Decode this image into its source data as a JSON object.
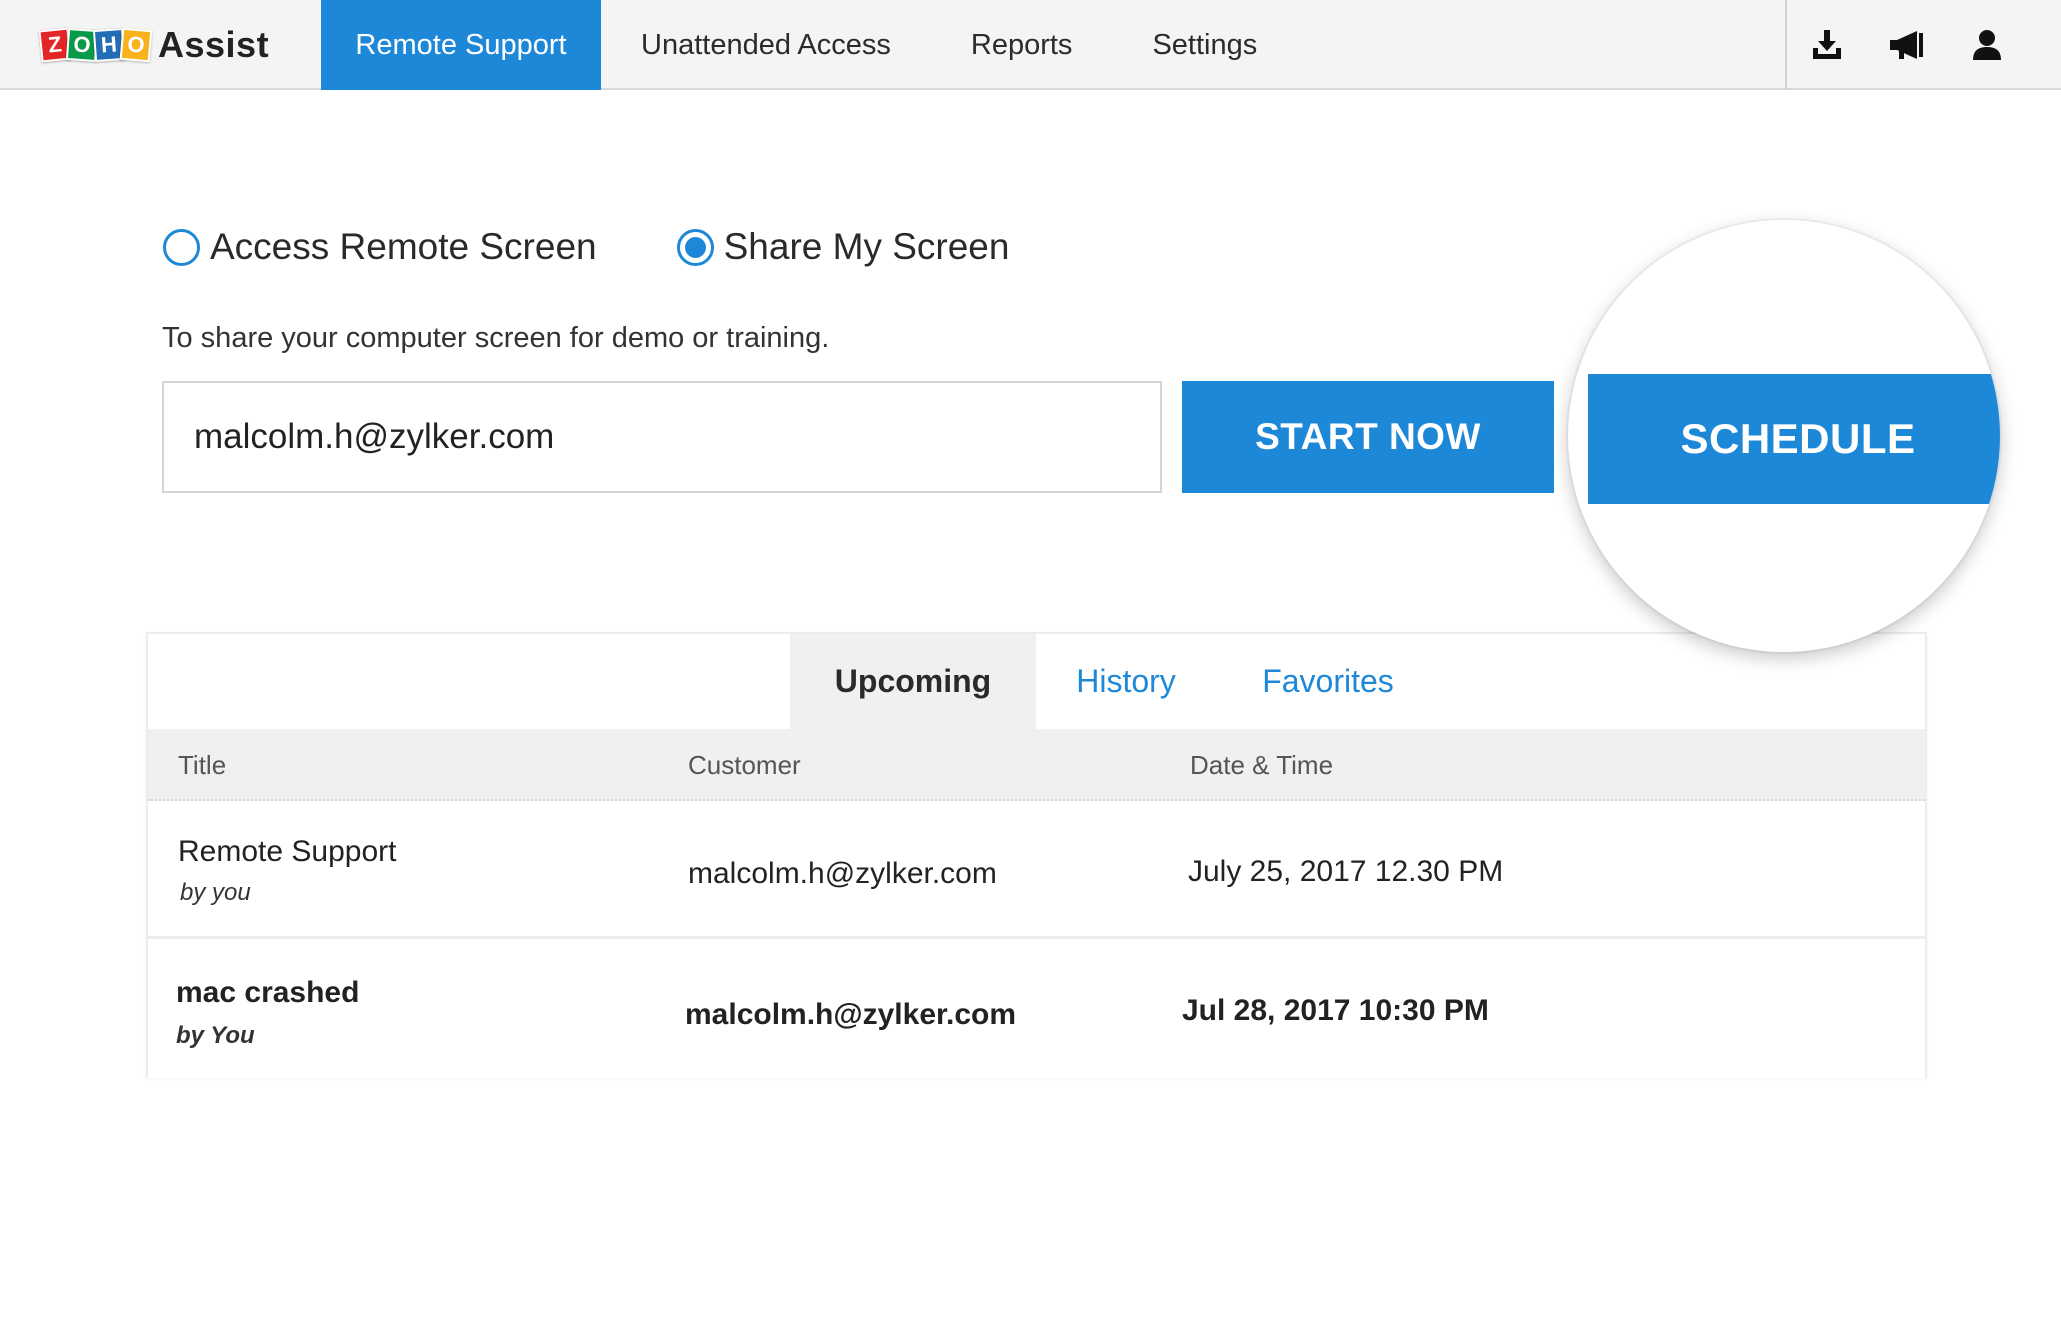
{
  "brand": {
    "logo_letters": [
      "Z",
      "O",
      "H",
      "O"
    ],
    "product": "Assist",
    "accent_color": "#1e88d8"
  },
  "nav": {
    "items": [
      {
        "label": "Remote Support",
        "active": true
      },
      {
        "label": "Unattended Access",
        "active": false
      },
      {
        "label": "Reports",
        "active": false
      },
      {
        "label": "Settings",
        "active": false
      }
    ]
  },
  "top_actions": {
    "icons": [
      "download-icon",
      "announcement-icon",
      "user-icon"
    ]
  },
  "mode": {
    "options": [
      {
        "label": "Access Remote Screen",
        "checked": false
      },
      {
        "label": "Share My Screen",
        "checked": true
      }
    ],
    "description": "To share your computer screen for demo or training."
  },
  "session_form": {
    "email_value": "malcolm.h@zylker.com",
    "start_label": "START NOW",
    "schedule_label": "SCHEDULE"
  },
  "sessions": {
    "tabs": [
      {
        "label": "Upcoming",
        "active": true
      },
      {
        "label": "History",
        "active": false
      },
      {
        "label": "Favorites",
        "active": false
      }
    ],
    "columns": [
      "Title",
      "Customer",
      "Date & Time"
    ],
    "rows": [
      {
        "title": "Remote Support",
        "by": "by you",
        "customer": "malcolm.h@zylker.com",
        "datetime": "July 25, 2017 12.30 PM"
      },
      {
        "title": "mac crashed",
        "by": "by You",
        "customer": "malcolm.h@zylker.com",
        "datetime": "Jul 28, 2017 10:30 PM"
      }
    ]
  }
}
